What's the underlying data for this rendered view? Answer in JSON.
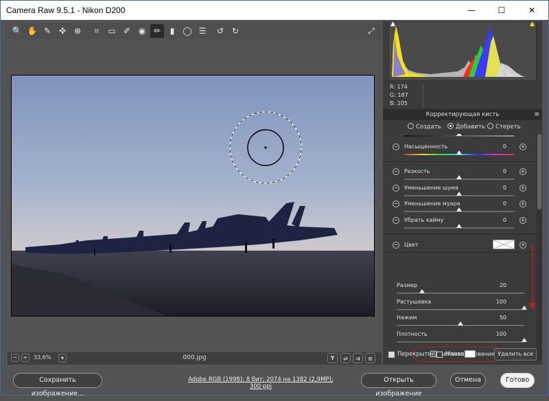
{
  "window": {
    "title": "Camera Raw 9.5.1  -  Nikon D200",
    "minimize": "—",
    "maximize": "☐",
    "close": "✕"
  },
  "toolbar": {
    "tools": [
      {
        "name": "zoom-icon",
        "glyph": "🔍"
      },
      {
        "name": "hand-icon",
        "glyph": "✋"
      },
      {
        "name": "white-balance-icon",
        "glyph": "✎"
      },
      {
        "name": "color-sampler-icon",
        "glyph": "✜"
      },
      {
        "name": "targeted-adjust-icon",
        "glyph": "⊕"
      },
      {
        "name": "crop-icon",
        "glyph": "⌗"
      },
      {
        "name": "straighten-icon",
        "glyph": "▭"
      },
      {
        "name": "spot-removal-icon",
        "glyph": "✐"
      },
      {
        "name": "red-eye-icon",
        "glyph": "◉"
      },
      {
        "name": "adjustment-brush-icon",
        "glyph": "✏"
      },
      {
        "name": "graduated-filter-icon",
        "glyph": "▮"
      },
      {
        "name": "radial-filter-icon",
        "glyph": "◯"
      },
      {
        "name": "preferences-icon",
        "glyph": "☰"
      },
      {
        "name": "rotate-left-icon",
        "glyph": "↺"
      },
      {
        "name": "rotate-right-icon",
        "glyph": "↻"
      }
    ],
    "fullscreen_glyph": "⤢"
  },
  "bottom": {
    "zoom_out": "−",
    "zoom_in": "+",
    "zoom_level": "33,6%",
    "zoom_dropdown": "▾",
    "filename": "000.jpg",
    "y_button": "Y"
  },
  "histogram": {
    "shadow_clip_glyph": "▲",
    "highlight_clip_glyph": "▲",
    "highlight_color": "#f5e400"
  },
  "rgb_readout": {
    "r": "R:  174",
    "g": "G:  187",
    "b": "B:  205"
  },
  "panel": {
    "title": "Корректирующая кисть",
    "menu_glyph": "≡",
    "modes": [
      {
        "label": "Создать",
        "on": false
      },
      {
        "label": "Добавить",
        "on": true
      },
      {
        "label": "Стереть",
        "on": false
      }
    ],
    "sliders": [
      {
        "label": "Насыщенность",
        "value": "0",
        "pos": 0.5,
        "hue": true
      },
      {
        "label": "Резкость",
        "value": "0",
        "pos": 0.5
      },
      {
        "label": "Уменьшение шума",
        "value": "0",
        "pos": 0.5
      },
      {
        "label": "Уменьшение муара",
        "value": "0",
        "pos": 0.5
      },
      {
        "label": "Убрать кайму",
        "value": "0",
        "pos": 0.5
      }
    ],
    "color_label": "Цвет",
    "brush": [
      {
        "label": "Размер",
        "value": "20",
        "pos": 0.2
      },
      {
        "label": "Растушевка",
        "value": "100",
        "pos": 1.0
      },
      {
        "label": "Нажим",
        "value": "50",
        "pos": 0.5
      },
      {
        "label": "Плотность",
        "value": "100",
        "pos": 1.0
      }
    ],
    "automask": "Автомаскирование",
    "accent": "#b22222"
  },
  "overlay": {
    "overlay_label": "Перекрытие",
    "mask_label": "Маска",
    "clear_all": "Удалить все"
  },
  "footer": {
    "save": "Сохранить изображение...",
    "workflow_link": "Adobe RGB (1998); 8 бит; 2074 на 1382 (2,9МР); 300 ppi",
    "open": "Открыть изображение",
    "cancel": "Отмена",
    "done": "Готово"
  }
}
